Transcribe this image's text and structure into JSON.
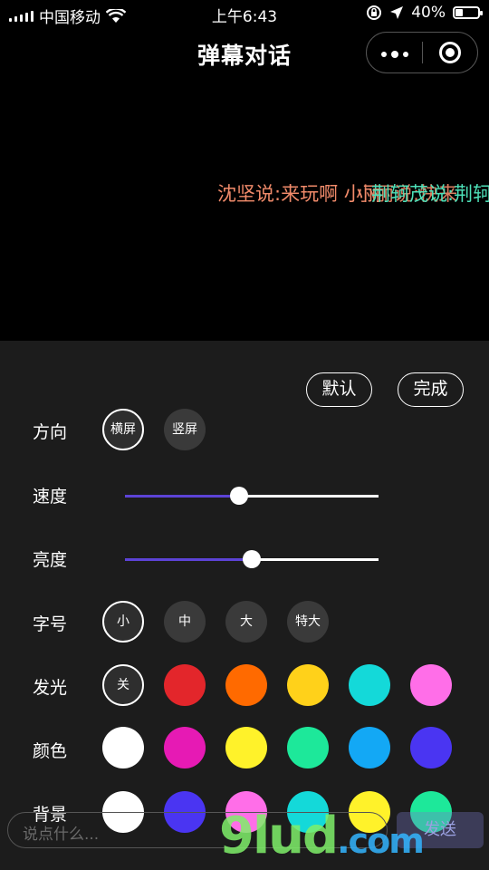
{
  "status_bar": {
    "carrier": "中国移动",
    "time": "上午6:43",
    "battery": "40%",
    "battery_level": 0.4
  },
  "nav": {
    "title": "弹幕对话"
  },
  "danmaku": [
    {
      "text": "沈坚说:来玩啊 小丽",
      "color": "#f08a6a"
    },
    {
      "text": "小丽说:快来",
      "color": "#f08a6a"
    },
    {
      "text": "荆轲茂说:荆轲",
      "color": "#4de0b8"
    }
  ],
  "panel": {
    "default_button": "默认",
    "done_button": "完成",
    "direction": {
      "label": "方向",
      "options": [
        "横屏",
        "竖屏"
      ],
      "selected": "横屏"
    },
    "speed": {
      "label": "速度",
      "value": 0.45
    },
    "brightness": {
      "label": "亮度",
      "value": 0.5
    },
    "font_size": {
      "label": "字号",
      "options": [
        "小",
        "中",
        "大",
        "特大"
      ],
      "selected": "小"
    },
    "glow": {
      "label": "发光",
      "off_label": "关",
      "colors": [
        "#e3262b",
        "#ff6a00",
        "#ffd11a",
        "#14d9d9",
        "#ff6ee8"
      ]
    },
    "color": {
      "label": "颜色",
      "colors": [
        "#ffffff",
        "#e61ab4",
        "#fff22a",
        "#1de89a",
        "#13a8f5",
        "#4a35f2"
      ]
    },
    "background": {
      "label": "背景",
      "colors": [
        "#ffffff",
        "#4a35f2",
        "#ff6ee8",
        "#14d9d9",
        "#fff22a",
        "#1de89a"
      ]
    }
  },
  "input": {
    "placeholder": "说点什么...",
    "send_label": "发送"
  },
  "watermark": {
    "main": "9lud",
    "suffix": ".com"
  }
}
